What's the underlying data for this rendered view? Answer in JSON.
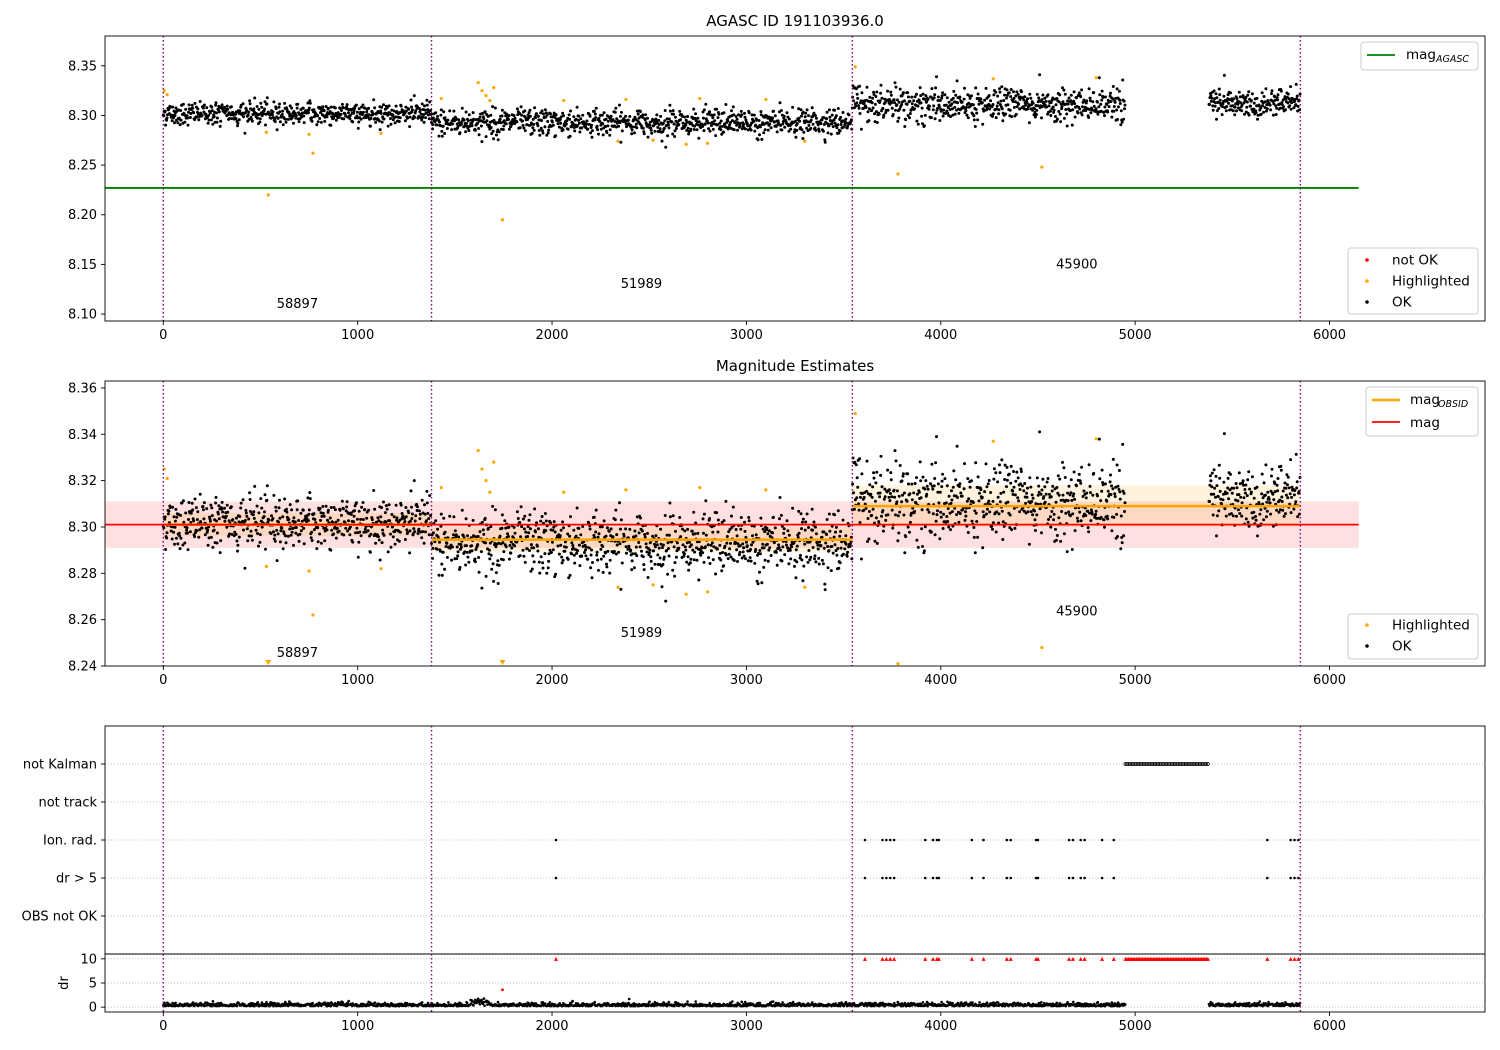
{
  "chart_data": [
    {
      "type": "scatter",
      "title": "AGASC ID 191103936.0",
      "xlim": [
        -300,
        6800
      ],
      "ylim": [
        8.093,
        8.38
      ],
      "x_ticks": [
        0,
        1000,
        2000,
        3000,
        4000,
        5000,
        6000
      ],
      "y_ticks": [
        "8.10",
        "8.15",
        "8.20",
        "8.25",
        "8.30",
        "8.35"
      ],
      "y_tick_values": [
        8.1,
        8.15,
        8.2,
        8.25,
        8.3,
        8.35
      ],
      "obsid_boundaries": [
        0,
        1380,
        3545,
        5850
      ],
      "obsid_labels": [
        {
          "text": "58897",
          "x": 690,
          "y": 8.106
        },
        {
          "text": "51989",
          "x": 2460,
          "y": 8.126
        },
        {
          "text": "45900",
          "x": 4700,
          "y": 8.146
        }
      ],
      "reference_line": {
        "name": "mag",
        "sub": "AGASC",
        "y": 8.227,
        "x_range": [
          -300,
          6150
        ],
        "color": "#008000"
      },
      "series": [
        {
          "name": "OK",
          "color": "#000000",
          "segments": [
            {
              "x_range": [
                0,
                1380
              ],
              "mean": 8.302,
              "spread": 0.006
            },
            {
              "x_range": [
                1380,
                3545
              ],
              "mean": 8.293,
              "spread": 0.007
            },
            {
              "x_range": [
                3545,
                4950
              ],
              "mean": 8.309,
              "spread": 0.008
            },
            {
              "x_range": [
                5380,
                5850
              ],
              "mean": 8.311,
              "spread": 0.007
            }
          ]
        },
        {
          "name": "Highlighted",
          "color": "#ffa500",
          "points": [
            [
              5,
              8.325
            ],
            [
              20,
              8.321
            ],
            [
              540,
              8.22
            ],
            [
              770,
              8.262
            ],
            [
              750,
              8.281
            ],
            [
              530,
              8.283
            ],
            [
              1120,
              8.282
            ],
            [
              1430,
              8.317
            ],
            [
              1620,
              8.333
            ],
            [
              1640,
              8.325
            ],
            [
              1660,
              8.32
            ],
            [
              1680,
              8.315
            ],
            [
              1700,
              8.328
            ],
            [
              1745,
              8.195
            ],
            [
              2060,
              8.315
            ],
            [
              2340,
              8.274
            ],
            [
              2380,
              8.316
            ],
            [
              2520,
              8.275
            ],
            [
              2690,
              8.271
            ],
            [
              2760,
              8.317
            ],
            [
              2800,
              8.272
            ],
            [
              3100,
              8.316
            ],
            [
              3300,
              8.274
            ],
            [
              3780,
              8.241
            ],
            [
              4270,
              8.337
            ],
            [
              4520,
              8.248
            ],
            [
              4800,
              8.338
            ],
            [
              3560,
              8.349
            ]
          ]
        },
        {
          "name": "not OK",
          "color": "#ff0000",
          "points": []
        }
      ],
      "legend_upper": [
        "mag_AGASC"
      ],
      "legend_lower": [
        "not OK",
        "Highlighted",
        "OK"
      ]
    },
    {
      "type": "scatter",
      "title": "Magnitude Estimates",
      "xlim": [
        -300,
        6800
      ],
      "ylim": [
        8.24,
        8.363
      ],
      "x_ticks": [
        0,
        1000,
        2000,
        3000,
        4000,
        5000,
        6000
      ],
      "y_ticks": [
        "8.24",
        "8.26",
        "8.28",
        "8.30",
        "8.32",
        "8.34",
        "8.36"
      ],
      "y_tick_values": [
        8.24,
        8.26,
        8.28,
        8.3,
        8.32,
        8.34,
        8.36
      ],
      "obsid_labels": [
        {
          "text": "58897",
          "x": 690,
          "y": 8.2438
        },
        {
          "text": "51989",
          "x": 2460,
          "y": 8.2525
        },
        {
          "text": "45900",
          "x": 4700,
          "y": 8.2617
        }
      ],
      "mag_line": {
        "name": "mag",
        "y": 8.301,
        "band": [
          8.291,
          8.311
        ],
        "x_range": [
          -300,
          6150
        ],
        "color": "#ff0000"
      },
      "obsid_mags": [
        {
          "x_range": [
            0,
            1380
          ],
          "mag": 8.301,
          "band": [
            8.296,
            8.306
          ]
        },
        {
          "x_range": [
            1380,
            3545
          ],
          "mag": 8.2945,
          "band": [
            8.289,
            8.3
          ]
        },
        {
          "x_range": [
            3545,
            5850
          ],
          "mag": 8.309,
          "band": [
            8.3,
            8.318
          ]
        }
      ],
      "obsid_mag_name": "mag",
      "obsid_mag_sub": "OBSID",
      "legend_upper": [
        "mag_OBSID",
        "mag"
      ],
      "legend_lower": [
        "Highlighted",
        "OK"
      ]
    },
    {
      "type": "scatter",
      "title": "",
      "xlim": [
        -300,
        6800
      ],
      "categories": [
        "not Kalman",
        "not track",
        "Ion. rad.",
        "dr > 5",
        "OBS not OK"
      ],
      "flag_points": {
        "not Kalman": {
          "x_range": [
            4950,
            5380
          ]
        },
        "Ion. rad.": {
          "x": [
            2020,
            3610,
            3700,
            3720,
            3740,
            3760,
            3920,
            3960,
            3980,
            3990,
            4160,
            4220,
            4340,
            4360,
            4490,
            4500,
            4660,
            4680,
            4720,
            4740,
            4830,
            4890,
            5680,
            5800,
            5820,
            5840
          ]
        },
        "dr > 5": {
          "x": [
            2020,
            3610,
            3700,
            3720,
            3740,
            3760,
            3920,
            3960,
            3980,
            3990,
            4160,
            4220,
            4340,
            4360,
            4490,
            4500,
            4660,
            4680,
            4720,
            4740,
            4830,
            4890,
            5680,
            5800,
            5820,
            5840
          ]
        }
      }
    },
    {
      "type": "scatter",
      "xlim": [
        -300,
        6800
      ],
      "ylim": [
        -1,
        11
      ],
      "ylabel": "dr",
      "x_ticks": [
        0,
        1000,
        2000,
        3000,
        4000,
        5000,
        6000
      ],
      "y_ticks": [
        "0",
        "5",
        "10"
      ],
      "y_tick_values": [
        0,
        5,
        10
      ],
      "capped_points_y": 10,
      "extra_point": [
        1745,
        3.6
      ]
    }
  ],
  "colors": {
    "ok": "#000000",
    "highlighted": "#ffa500",
    "not_ok": "#ff0000",
    "agasc": "#008000",
    "mag": "#ff0000",
    "obsid": "#ffa500",
    "boundary": "#800080"
  }
}
